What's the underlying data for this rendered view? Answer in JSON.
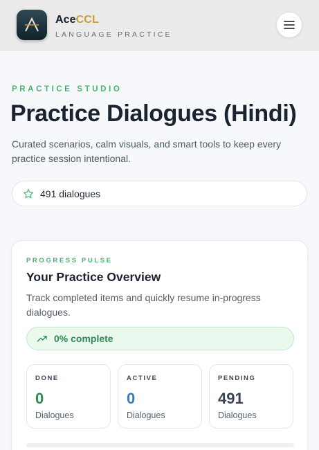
{
  "header": {
    "brand_main": "Ace",
    "brand_accent": "CCL",
    "brand_sub": "LANGUAGE PRACTICE"
  },
  "hero": {
    "eyebrow": "PRACTICE STUDIO",
    "title": "Practice Dialogues (Hindi)",
    "subtitle": "Curated scenarios, calm visuals, and smart tools to keep every practice session intentional.",
    "count_label": "491 dialogues"
  },
  "progress": {
    "eyebrow": "PROGRESS PULSE",
    "title": "Your Practice Overview",
    "description": "Track completed items and quickly resume in-progress dialogues.",
    "complete_label": "0% complete",
    "percent": 0,
    "stats": {
      "done": {
        "label": "DONE",
        "value": "0",
        "unit": "Dialogues"
      },
      "active": {
        "label": "ACTIVE",
        "value": "0",
        "unit": "Dialogues"
      },
      "pending": {
        "label": "PENDING",
        "value": "491",
        "unit": "Dialogues"
      }
    }
  },
  "colors": {
    "accent_green": "#4caf73",
    "brand_gold": "#c99a3e",
    "active_blue": "#3c79b8"
  }
}
